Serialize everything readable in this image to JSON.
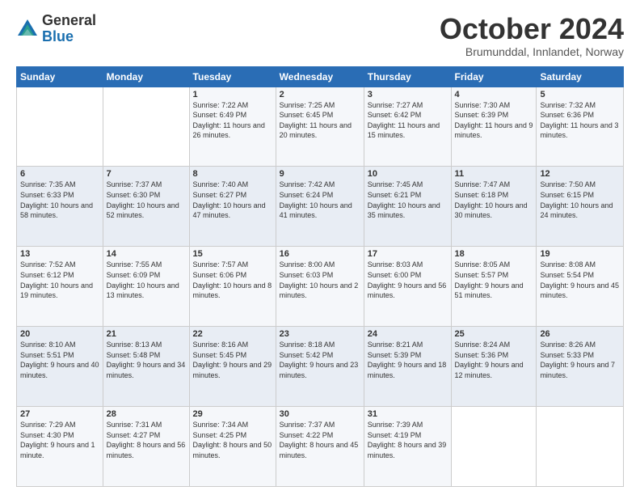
{
  "logo": {
    "general": "General",
    "blue": "Blue"
  },
  "header": {
    "month": "October 2024",
    "location": "Brumunddal, Innlandet, Norway"
  },
  "weekdays": [
    "Sunday",
    "Monday",
    "Tuesday",
    "Wednesday",
    "Thursday",
    "Friday",
    "Saturday"
  ],
  "weeks": [
    [
      {
        "day": "",
        "info": ""
      },
      {
        "day": "",
        "info": ""
      },
      {
        "day": "1",
        "info": "Sunrise: 7:22 AM\nSunset: 6:49 PM\nDaylight: 11 hours\nand 26 minutes."
      },
      {
        "day": "2",
        "info": "Sunrise: 7:25 AM\nSunset: 6:45 PM\nDaylight: 11 hours\nand 20 minutes."
      },
      {
        "day": "3",
        "info": "Sunrise: 7:27 AM\nSunset: 6:42 PM\nDaylight: 11 hours\nand 15 minutes."
      },
      {
        "day": "4",
        "info": "Sunrise: 7:30 AM\nSunset: 6:39 PM\nDaylight: 11 hours\nand 9 minutes."
      },
      {
        "day": "5",
        "info": "Sunrise: 7:32 AM\nSunset: 6:36 PM\nDaylight: 11 hours\nand 3 minutes."
      }
    ],
    [
      {
        "day": "6",
        "info": "Sunrise: 7:35 AM\nSunset: 6:33 PM\nDaylight: 10 hours\nand 58 minutes."
      },
      {
        "day": "7",
        "info": "Sunrise: 7:37 AM\nSunset: 6:30 PM\nDaylight: 10 hours\nand 52 minutes."
      },
      {
        "day": "8",
        "info": "Sunrise: 7:40 AM\nSunset: 6:27 PM\nDaylight: 10 hours\nand 47 minutes."
      },
      {
        "day": "9",
        "info": "Sunrise: 7:42 AM\nSunset: 6:24 PM\nDaylight: 10 hours\nand 41 minutes."
      },
      {
        "day": "10",
        "info": "Sunrise: 7:45 AM\nSunset: 6:21 PM\nDaylight: 10 hours\nand 35 minutes."
      },
      {
        "day": "11",
        "info": "Sunrise: 7:47 AM\nSunset: 6:18 PM\nDaylight: 10 hours\nand 30 minutes."
      },
      {
        "day": "12",
        "info": "Sunrise: 7:50 AM\nSunset: 6:15 PM\nDaylight: 10 hours\nand 24 minutes."
      }
    ],
    [
      {
        "day": "13",
        "info": "Sunrise: 7:52 AM\nSunset: 6:12 PM\nDaylight: 10 hours\nand 19 minutes."
      },
      {
        "day": "14",
        "info": "Sunrise: 7:55 AM\nSunset: 6:09 PM\nDaylight: 10 hours\nand 13 minutes."
      },
      {
        "day": "15",
        "info": "Sunrise: 7:57 AM\nSunset: 6:06 PM\nDaylight: 10 hours\nand 8 minutes."
      },
      {
        "day": "16",
        "info": "Sunrise: 8:00 AM\nSunset: 6:03 PM\nDaylight: 10 hours\nand 2 minutes."
      },
      {
        "day": "17",
        "info": "Sunrise: 8:03 AM\nSunset: 6:00 PM\nDaylight: 9 hours\nand 56 minutes."
      },
      {
        "day": "18",
        "info": "Sunrise: 8:05 AM\nSunset: 5:57 PM\nDaylight: 9 hours\nand 51 minutes."
      },
      {
        "day": "19",
        "info": "Sunrise: 8:08 AM\nSunset: 5:54 PM\nDaylight: 9 hours\nand 45 minutes."
      }
    ],
    [
      {
        "day": "20",
        "info": "Sunrise: 8:10 AM\nSunset: 5:51 PM\nDaylight: 9 hours\nand 40 minutes."
      },
      {
        "day": "21",
        "info": "Sunrise: 8:13 AM\nSunset: 5:48 PM\nDaylight: 9 hours\nand 34 minutes."
      },
      {
        "day": "22",
        "info": "Sunrise: 8:16 AM\nSunset: 5:45 PM\nDaylight: 9 hours\nand 29 minutes."
      },
      {
        "day": "23",
        "info": "Sunrise: 8:18 AM\nSunset: 5:42 PM\nDaylight: 9 hours\nand 23 minutes."
      },
      {
        "day": "24",
        "info": "Sunrise: 8:21 AM\nSunset: 5:39 PM\nDaylight: 9 hours\nand 18 minutes."
      },
      {
        "day": "25",
        "info": "Sunrise: 8:24 AM\nSunset: 5:36 PM\nDaylight: 9 hours\nand 12 minutes."
      },
      {
        "day": "26",
        "info": "Sunrise: 8:26 AM\nSunset: 5:33 PM\nDaylight: 9 hours\nand 7 minutes."
      }
    ],
    [
      {
        "day": "27",
        "info": "Sunrise: 7:29 AM\nSunset: 4:30 PM\nDaylight: 9 hours\nand 1 minute."
      },
      {
        "day": "28",
        "info": "Sunrise: 7:31 AM\nSunset: 4:27 PM\nDaylight: 8 hours\nand 56 minutes."
      },
      {
        "day": "29",
        "info": "Sunrise: 7:34 AM\nSunset: 4:25 PM\nDaylight: 8 hours\nand 50 minutes."
      },
      {
        "day": "30",
        "info": "Sunrise: 7:37 AM\nSunset: 4:22 PM\nDaylight: 8 hours\nand 45 minutes."
      },
      {
        "day": "31",
        "info": "Sunrise: 7:39 AM\nSunset: 4:19 PM\nDaylight: 8 hours\nand 39 minutes."
      },
      {
        "day": "",
        "info": ""
      },
      {
        "day": "",
        "info": ""
      }
    ]
  ]
}
